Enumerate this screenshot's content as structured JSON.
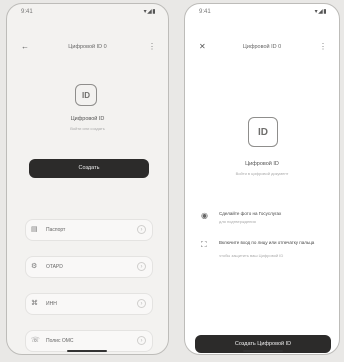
{
  "left": {
    "status": {
      "time": "9:41",
      "icons": "▾◢▮"
    },
    "header": {
      "back": "←",
      "title": "Цифровой ID 0",
      "more": "⋮"
    },
    "hero": {
      "title": "Цифровой ID",
      "subtitle": "Войти или создать",
      "button": "Создать"
    },
    "methods": [
      {
        "icon": "▤",
        "label": "Паспорт",
        "chevron": "›"
      },
      {
        "icon": "⚙",
        "label": "OTAPD",
        "chevron": "›"
      },
      {
        "icon": "⌘",
        "label": "ИНН",
        "chevron": "›"
      },
      {
        "icon": "☏",
        "label": "Полис ОМС",
        "chevron": "›"
      }
    ]
  },
  "right": {
    "status": {
      "time": "9:41",
      "icons": "▾◢▮"
    },
    "header": {
      "close": "✕",
      "title": "Цифровой ID 0",
      "more": "⋮"
    },
    "hero": {
      "icon_text": "ID",
      "title": "Цифровой ID",
      "subtitle": "Войти в цифровой документ"
    },
    "steps": [
      {
        "icon": "◉",
        "title": "Сделайте фото на Госуслугах",
        "subtitle": "для подтверждения"
      },
      {
        "icon": "⛶",
        "title": "Включите вход по лицу или отпечатку пальца",
        "subtitle": "чтобы защитить ваш Цифровой ID"
      }
    ],
    "button": "Создать Цифровой ID"
  },
  "icons": {
    "id_text": "ID"
  }
}
